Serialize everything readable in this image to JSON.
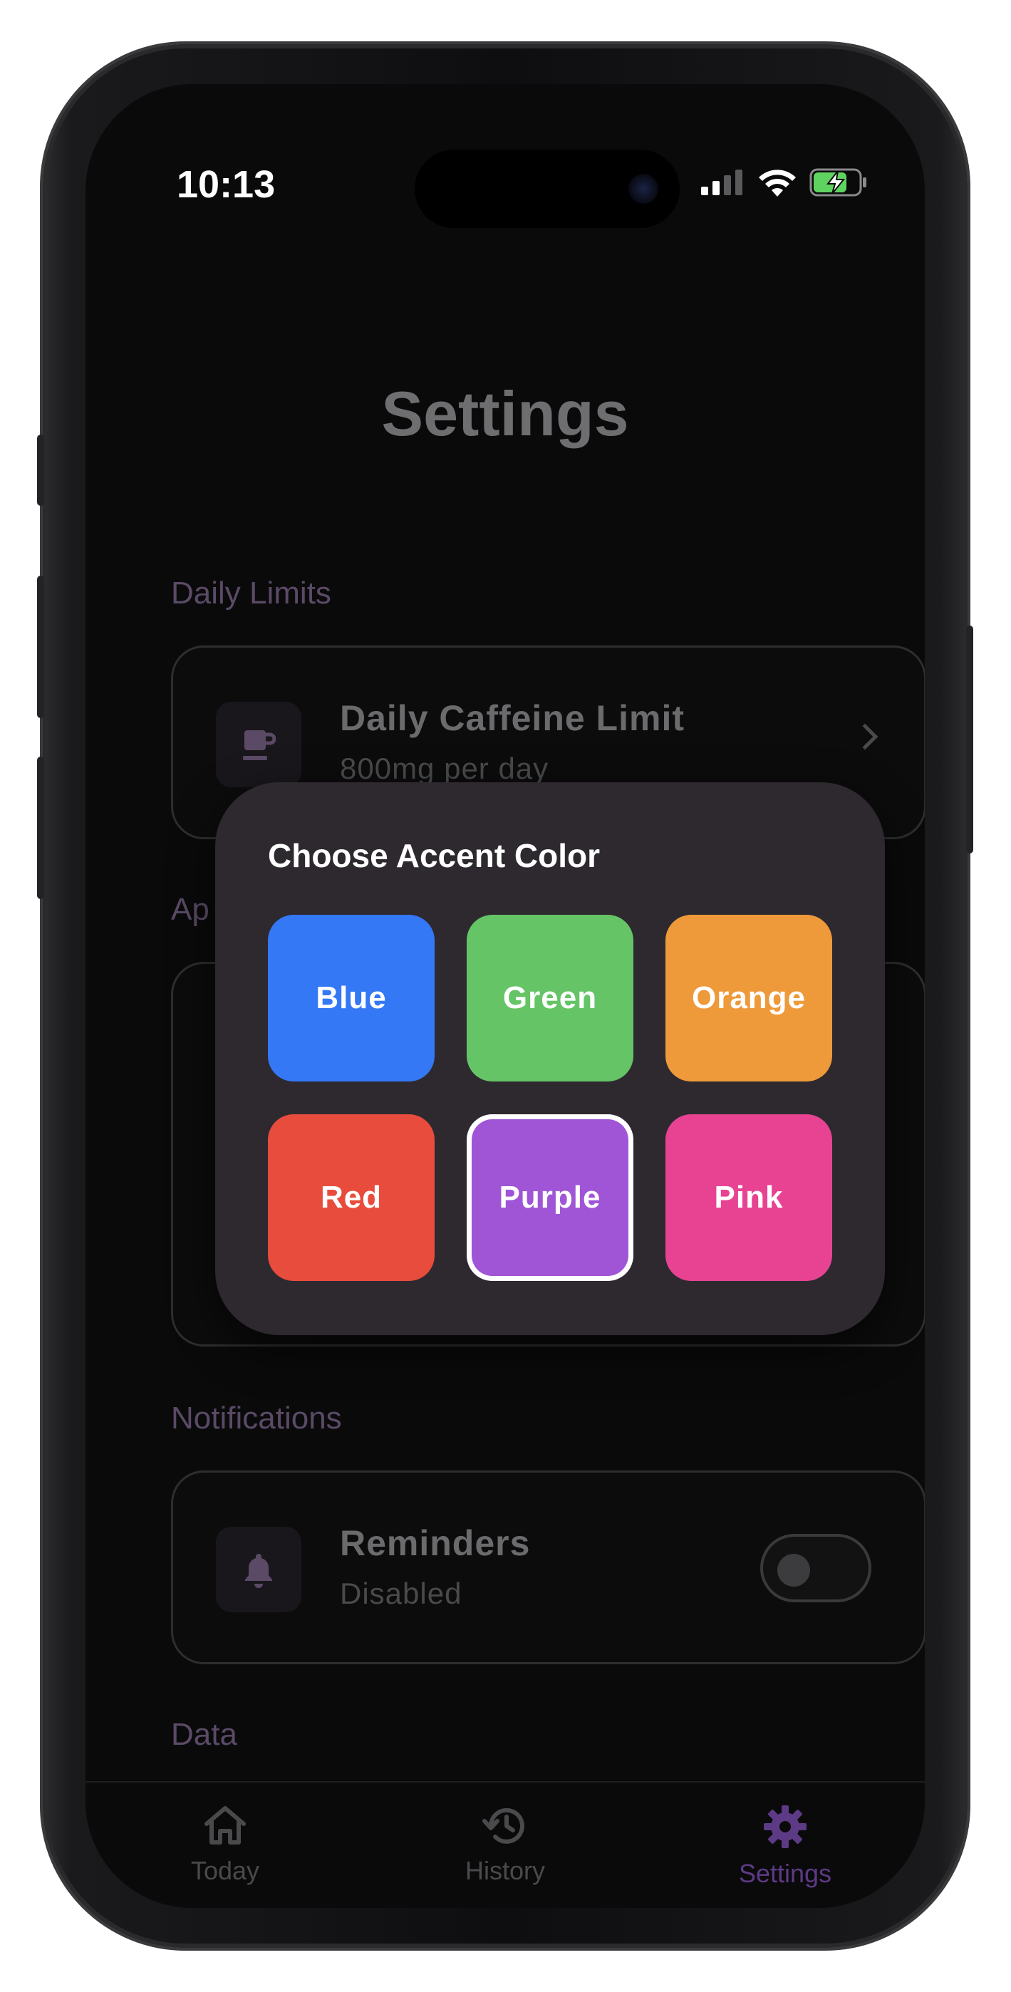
{
  "status_bar": {
    "time": "10:13"
  },
  "page": {
    "title": "Settings"
  },
  "sections": {
    "daily_limits": {
      "label": "Daily Limits",
      "item": {
        "title": "Daily Caffeine Limit",
        "subtitle": "800mg per day",
        "icon": "coffee-cup-icon"
      }
    },
    "appearance": {
      "label_visible_part": "Ap"
    },
    "notifications": {
      "label": "Notifications",
      "item": {
        "title": "Reminders",
        "subtitle": "Disabled",
        "icon": "bell-icon",
        "toggle_on": false
      }
    },
    "data": {
      "label": "Data"
    }
  },
  "modal": {
    "title": "Choose Accent Color",
    "options": [
      {
        "label": "Blue",
        "color": "#3478f6",
        "selected": false
      },
      {
        "label": "Green",
        "color": "#65c466",
        "selected": false
      },
      {
        "label": "Orange",
        "color": "#ee9a3a",
        "selected": false
      },
      {
        "label": "Red",
        "color": "#e84c3d",
        "selected": false
      },
      {
        "label": "Purple",
        "color": "#a055d6",
        "selected": true
      },
      {
        "label": "Pink",
        "color": "#e84393",
        "selected": false
      }
    ]
  },
  "tabbar": {
    "tabs": [
      {
        "label": "Today",
        "icon": "home-icon",
        "active": false
      },
      {
        "label": "History",
        "icon": "history-icon",
        "active": false
      },
      {
        "label": "Settings",
        "icon": "gear-icon",
        "active": true
      }
    ],
    "active_color": "#5d3a85",
    "inactive_color": "#4a4a4c"
  }
}
